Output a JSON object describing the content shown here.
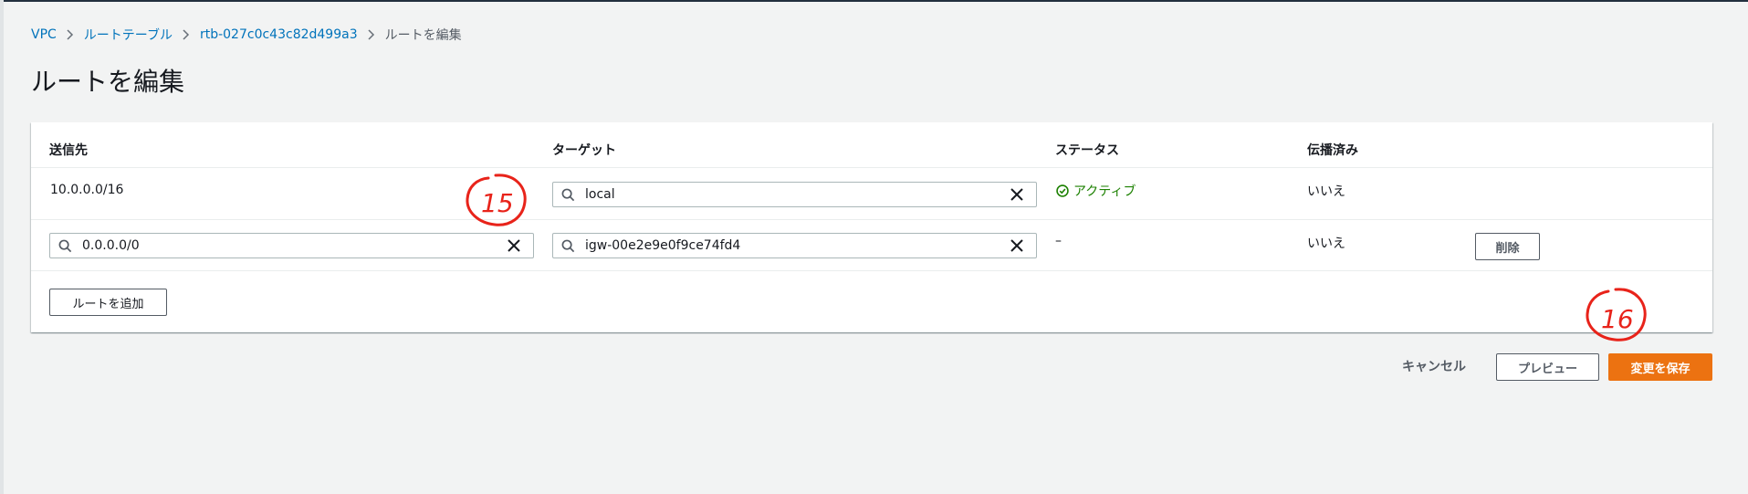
{
  "breadcrumb": {
    "items": [
      "VPC",
      "ルートテーブル",
      "rtb-027c0c43c82d499a3"
    ],
    "current": "ルートを編集"
  },
  "page": {
    "title": "ルートを編集"
  },
  "table": {
    "headers": {
      "destination": "送信先",
      "target": "ターゲット",
      "status": "ステータス",
      "propagated": "伝播済み"
    },
    "rows": [
      {
        "destination": "10.0.0.0/16",
        "target": "local",
        "status": "アクティブ",
        "propagated": "いいえ"
      },
      {
        "destination": "0.0.0.0/0",
        "target": "igw-00e2e9e0f9ce74fd4",
        "status": "–",
        "propagated": "いいえ",
        "remove_label": "削除"
      }
    ],
    "add_route_label": "ルートを追加"
  },
  "footer": {
    "cancel_label": "キャンセル",
    "preview_label": "プレビュー",
    "save_label": "変更を保存"
  },
  "annotations": {
    "a15": "15",
    "a16": "16"
  },
  "colors": {
    "link": "#0073bb",
    "primary": "#ec7211",
    "success": "#1d8102",
    "annotation": "#e8231a"
  },
  "icons": [
    "chevron-right-icon",
    "search-icon",
    "close-icon",
    "status-success-icon"
  ]
}
